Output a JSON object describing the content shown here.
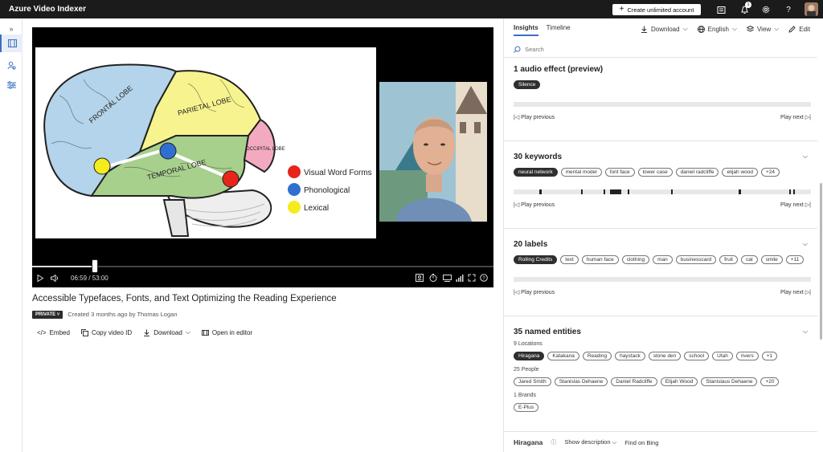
{
  "app": {
    "title": "Azure Video Indexer",
    "create_button": "Create unlimited account",
    "notification_count": "1"
  },
  "video": {
    "title": "Accessible Typefaces, Fonts, and Text Optimizing the Reading Experience",
    "current_time": "06:59",
    "separator": "/",
    "duration": "53:00",
    "progress_fraction": 0.135,
    "privacy": "PRIVATE",
    "created": "Created 3 months ago by Thomas Logan"
  },
  "slide": {
    "lobes": {
      "frontal": "FRONTAL LOBE",
      "parietal": "PARIETAL LOBE",
      "temporal": "TEMPORAL LOBE",
      "occipital": "OCCIPITAL LOBE"
    },
    "legend": [
      {
        "label": "Visual Word Forms",
        "color": "#e8241b"
      },
      {
        "label": "Phonological",
        "color": "#2f6fd0"
      },
      {
        "label": "Lexical",
        "color": "#f4ec1c"
      }
    ]
  },
  "actions": {
    "embed": "Embed",
    "copy_id": "Copy video ID",
    "download": "Download",
    "open_editor": "Open in editor"
  },
  "panel": {
    "tabs": [
      "Insights",
      "Timeline"
    ],
    "download": "Download",
    "language": "English",
    "view": "View",
    "edit": "Edit",
    "search_placeholder": "Search",
    "play_previous": "Play previous",
    "play_next": "Play next"
  },
  "audio": {
    "title": "1 audio effect (preview)",
    "chips": [
      "Silence"
    ]
  },
  "keywords": {
    "title": "30 keywords",
    "chips": [
      "neural network",
      "mental model",
      "font face",
      "lower case",
      "daniel radcliffe",
      "elijah wood",
      "+24"
    ]
  },
  "labels": {
    "title": "20 labels",
    "chips": [
      "Rolling Credits",
      "text",
      "human face",
      "clothing",
      "man",
      "businesscard",
      "fruit",
      "cat",
      "smile",
      "+11"
    ]
  },
  "entities": {
    "title": "35 named entities",
    "locations_label": "9 Locations",
    "locations": [
      "Hiragana",
      "Katakana",
      "Reading",
      "haystack",
      "stone den",
      "school",
      "Utah",
      "rivers",
      "+1"
    ],
    "people_label": "25 People",
    "people": [
      "Jared Smith",
      "Stanislas Dehaene",
      "Daniel Radcliffe",
      "Elijah Wood",
      "Stanislaus Dehaene",
      "+20"
    ],
    "brands_label": "1 Brands",
    "brands": [
      "E-Plus"
    ]
  },
  "detail": {
    "name": "Hiragana",
    "show_description": "Show description",
    "find_on_bing": "Find on Bing"
  }
}
